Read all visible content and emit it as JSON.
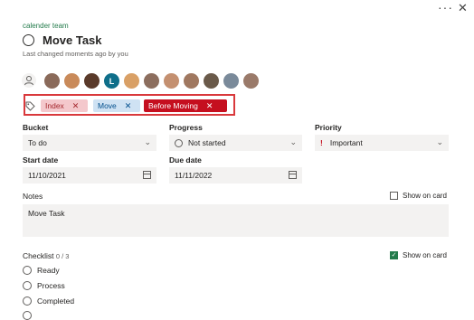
{
  "window": {
    "more_icon": "ellipsis-icon",
    "close_icon": "close-icon"
  },
  "task": {
    "plan_name": "calender team",
    "title": "Move Task",
    "changed_text": "Last changed moments ago by you"
  },
  "assignees": {
    "avatar_initial": "L",
    "avatar_colors": [
      "#8a6a5a",
      "#c98a5a",
      "#5a3a2a",
      "#0f6f8a",
      "#d9a066",
      "#8c6e5e",
      "#c49070",
      "#a07860",
      "#6a5a4a",
      "#7a8a9a",
      "#9a7a6a"
    ]
  },
  "labels": [
    {
      "name": "Index",
      "color": "#f4c8cc"
    },
    {
      "name": "Move",
      "color": "#cfe2f3"
    },
    {
      "name": "Before Moving",
      "color": "#c50f1f"
    }
  ],
  "bucket": {
    "label": "Bucket",
    "value": "To do"
  },
  "progress": {
    "label": "Progress",
    "value": "Not started"
  },
  "priority": {
    "label": "Priority",
    "value": "Important"
  },
  "start_date": {
    "label": "Start date",
    "value": "11/10/2021"
  },
  "due_date": {
    "label": "Due date",
    "value": "11/11/2022"
  },
  "notes": {
    "label": "Notes",
    "value": "Move Task",
    "show_on_card": "Show on card",
    "show_checked": false
  },
  "checklist": {
    "label": "Checklist",
    "count": "0 / 3",
    "show_on_card": "Show on card",
    "show_checked": true,
    "items": [
      "Ready",
      "Process",
      "Completed"
    ]
  }
}
